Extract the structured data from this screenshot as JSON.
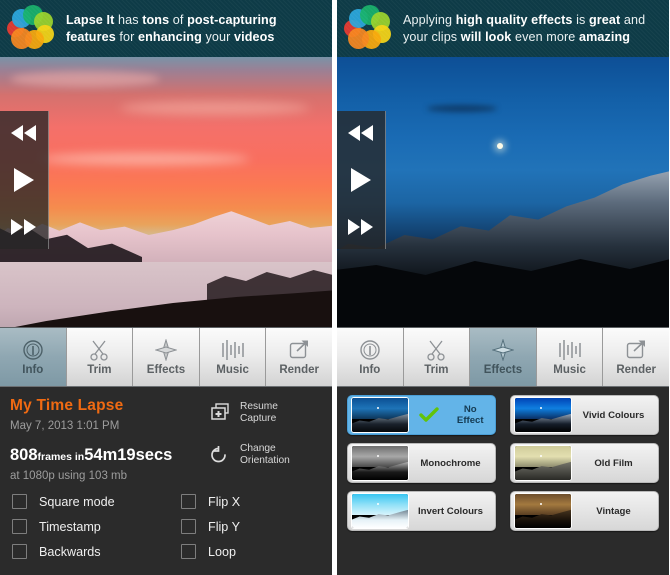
{
  "panels": [
    {
      "promo": {
        "logo_icon": "lapse-it-logo-icon",
        "line1_parts": [
          {
            "t": "Lapse It",
            "b": true
          },
          {
            "t": " has ",
            "b": false
          },
          {
            "t": "tons",
            "b": true
          },
          {
            "t": " of ",
            "b": false
          },
          {
            "t": "post-capturing",
            "b": true
          }
        ],
        "line2_parts": [
          {
            "t": "features",
            "b": true
          },
          {
            "t": " for ",
            "b": false
          },
          {
            "t": "enhancing",
            "b": true
          },
          {
            "t": " your ",
            "b": false
          },
          {
            "t": "videos",
            "b": true
          }
        ],
        "bg_color": "#0e3b47"
      },
      "preview": {
        "scene": "sunset-mountain-lake",
        "controls": [
          {
            "name": "rewind-button",
            "icon": "rewind-icon"
          },
          {
            "name": "play-button",
            "icon": "play-icon"
          },
          {
            "name": "fast-forward-button",
            "icon": "fast-forward-icon"
          }
        ]
      },
      "tabs": [
        {
          "label": "Info",
          "icon": "info-circle-icon",
          "active": true
        },
        {
          "label": "Trim",
          "icon": "scissors-icon",
          "active": false
        },
        {
          "label": "Effects",
          "icon": "diamond-sparkle-icon",
          "active": false
        },
        {
          "label": "Music",
          "icon": "equalizer-bars-icon",
          "active": false
        },
        {
          "label": "Render",
          "icon": "export-square-arrow-icon",
          "active": false
        }
      ],
      "info": {
        "project_title": "My Time Lapse",
        "project_title_color": "#f06a12",
        "date": "May 7, 2013 1:01 PM",
        "frames_count": "808",
        "frames_word": "frames in",
        "duration": "54m19secs",
        "quality": "at 1080p using 103 mb",
        "actions": [
          {
            "label_line1": "Resume",
            "label_line2": "Capture",
            "icon": "add-frames-icon",
            "name": "resume-capture-button"
          },
          {
            "label_line1": "Change",
            "label_line2": "Orientation",
            "icon": "rotate-icon",
            "name": "change-orientation-button"
          }
        ],
        "options_left": [
          {
            "label": "Square mode",
            "checked": false
          },
          {
            "label": "Timestamp",
            "checked": false
          },
          {
            "label": "Backwards",
            "checked": false
          }
        ],
        "options_right": [
          {
            "label": "Flip X",
            "checked": false
          },
          {
            "label": "Flip Y",
            "checked": false
          },
          {
            "label": "Loop",
            "checked": false
          }
        ]
      }
    },
    {
      "promo": {
        "logo_icon": "lapse-it-logo-icon",
        "line1_parts": [
          {
            "t": "Applying ",
            "b": false
          },
          {
            "t": "high quality effects",
            "b": true
          },
          {
            "t": " is ",
            "b": false
          },
          {
            "t": "great",
            "b": true
          },
          {
            "t": " and",
            "b": false
          }
        ],
        "line2_parts": [
          {
            "t": "your clips ",
            "b": false
          },
          {
            "t": "will look",
            "b": true
          },
          {
            "t": " even more ",
            "b": false
          },
          {
            "t": "amazing",
            "b": true
          }
        ],
        "bg_color": "#0e3b47"
      },
      "preview": {
        "scene": "night-blue-mountain",
        "controls": [
          {
            "name": "rewind-button",
            "icon": "rewind-icon"
          },
          {
            "name": "play-button",
            "icon": "play-icon"
          },
          {
            "name": "fast-forward-button",
            "icon": "fast-forward-icon"
          }
        ]
      },
      "tabs": [
        {
          "label": "Info",
          "icon": "info-circle-icon",
          "active": false
        },
        {
          "label": "Trim",
          "icon": "scissors-icon",
          "active": false
        },
        {
          "label": "Effects",
          "icon": "diamond-sparkle-icon",
          "active": true
        },
        {
          "label": "Music",
          "icon": "equalizer-bars-icon",
          "active": false
        },
        {
          "label": "Render",
          "icon": "export-square-arrow-icon",
          "active": false
        }
      ],
      "effects": {
        "selected_color": "#63b4e8",
        "check_icon": "green-check-icon",
        "items": [
          {
            "label": "No Effect",
            "selected": true,
            "scene": "sc-normal"
          },
          {
            "label": "Vivid Colours",
            "selected": false,
            "scene": "sc-vivid"
          },
          {
            "label": "Monochrome",
            "selected": false,
            "scene": "sc-mono"
          },
          {
            "label": "Old Film",
            "selected": false,
            "scene": "sc-old"
          },
          {
            "label": "Invert Colours",
            "selected": false,
            "scene": "sc-invert"
          },
          {
            "label": "Vintage",
            "selected": false,
            "scene": "sc-vint"
          }
        ]
      }
    }
  ]
}
